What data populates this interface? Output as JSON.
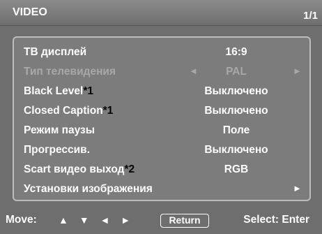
{
  "header": {
    "title": "VIDEO",
    "page": "1/1"
  },
  "menu": {
    "items": [
      {
        "label": "ТВ дисплей",
        "note": "",
        "value": "16:9",
        "disabled": false,
        "left_arrow": "",
        "right_arrow": ""
      },
      {
        "label": "Тип телевидения",
        "note": "",
        "value": "PAL",
        "disabled": true,
        "left_arrow": "◄",
        "right_arrow": "►"
      },
      {
        "label": "Black Level",
        "note": "*1",
        "value": "Выключено",
        "disabled": false,
        "left_arrow": "",
        "right_arrow": ""
      },
      {
        "label": "Closed Caption",
        "note": "*1",
        "value": "Выключено",
        "disabled": false,
        "left_arrow": "",
        "right_arrow": ""
      },
      {
        "label": "Режим паузы",
        "note": "",
        "value": "Поле",
        "disabled": false,
        "left_arrow": "",
        "right_arrow": ""
      },
      {
        "label": "Прогрессив.",
        "note": "",
        "value": "Выключено",
        "disabled": false,
        "left_arrow": "",
        "right_arrow": ""
      },
      {
        "label": "Scart видео выход",
        "note": "*2",
        "value": "RGB",
        "disabled": false,
        "left_arrow": "",
        "right_arrow": ""
      },
      {
        "label": "Установки изображения",
        "note": "",
        "value": "",
        "disabled": false,
        "left_arrow": "",
        "right_arrow": "►"
      }
    ]
  },
  "footer": {
    "move_label": "Move:",
    "move_arrows": "▲ ▼ ◄ ►",
    "return_label": "Return",
    "select_label": "Select: Enter"
  }
}
